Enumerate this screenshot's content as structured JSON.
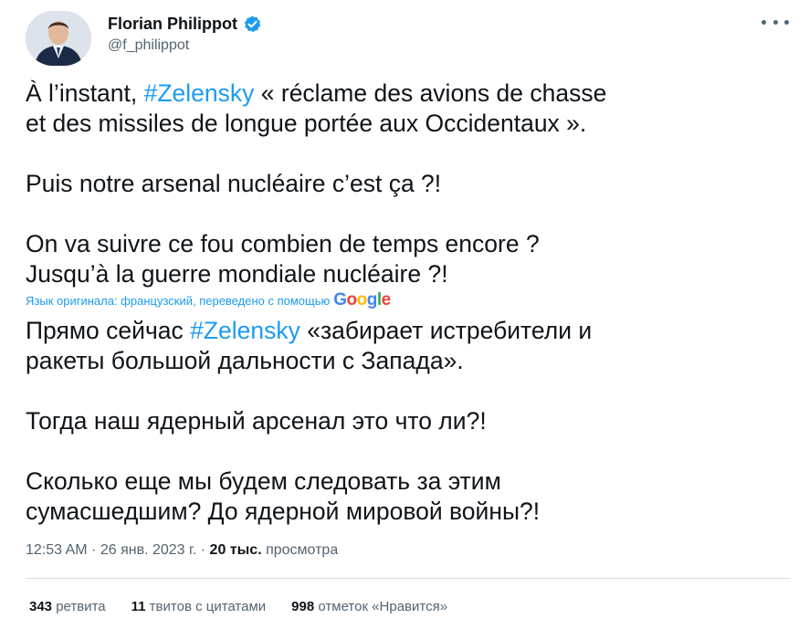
{
  "author": {
    "display_name": "Florian Philippot",
    "handle": "@f_philippot"
  },
  "tweet": {
    "original": {
      "line1_pre": "À l’instant, ",
      "line1_hashtag": "#Zelensky",
      "line1_post": " « réclame des avions de chasse",
      "line2": "et des missiles de longue portée aux Occidentaux ».",
      "line3": "Puis notre arsenal nucléaire c’est ça ?!",
      "line4": "On va suivre ce fou combien de temps encore ?",
      "line5": "Jusqu’à la guerre mondiale nucléaire ?!"
    },
    "translation_note": "Язык оригинала: французский, переведено с помощью",
    "google_logo": "Google",
    "translated": {
      "line1_pre": "Прямо сейчас ",
      "line1_hashtag": "#Zelensky",
      "line1_post": " «забирает истребители и",
      "line2": "ракеты большой дальности с Запада».",
      "line3": "Тогда наш ядерный арсенал это что ли?!",
      "line4": "Сколько еще мы будем следовать за этим",
      "line5": "сумасшедшим? До ядерной мировой войны?!"
    }
  },
  "meta": {
    "time": "12:53 AM",
    "sep1": " · ",
    "date": "26 янв. 2023 г.",
    "sep2": " · ",
    "views_count": "20 тыс.",
    "views_label": " просмотра"
  },
  "stats": {
    "retweets_count": "343",
    "retweets_label": " ретвита",
    "quotes_count": "11",
    "quotes_label": " твитов с цитатами",
    "likes_count": "998",
    "likes_label": " отметок «Нравится»"
  },
  "colors": {
    "accent": "#1d9bf0",
    "text": "#0f1419",
    "secondary": "#536471"
  },
  "icons": {
    "verified": "verified-badge-icon",
    "more": "more-options-icon"
  }
}
